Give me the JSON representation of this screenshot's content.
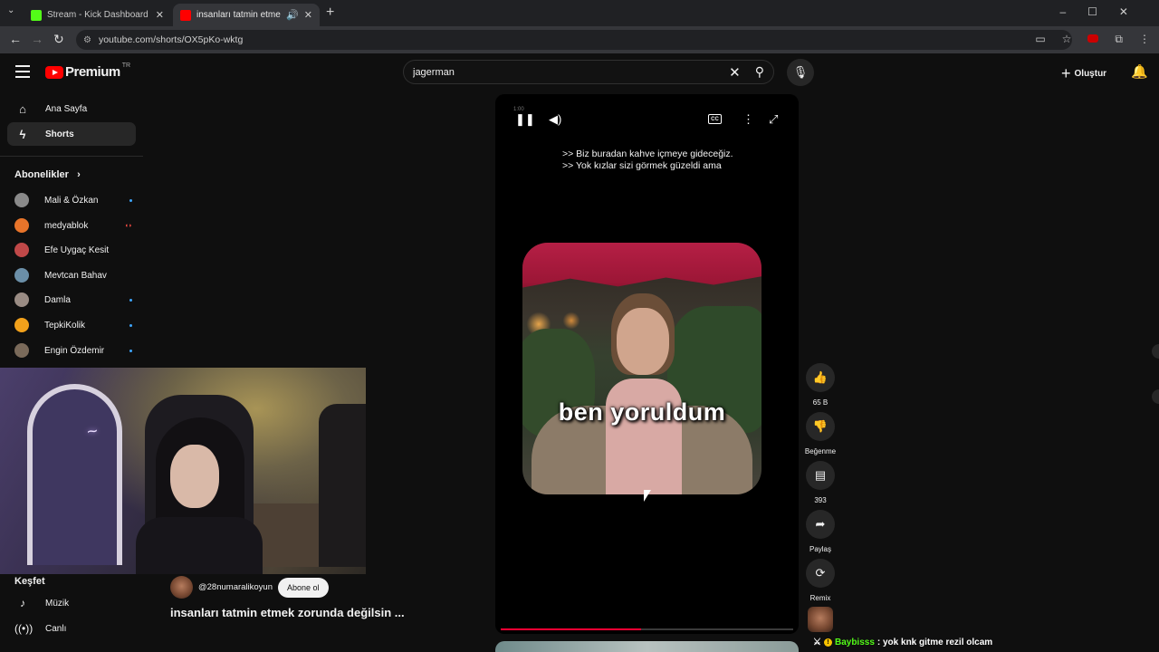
{
  "browser": {
    "tabs": [
      {
        "title": "Stream - Kick Dashboard",
        "favicon_color": "#53fc18"
      },
      {
        "title": "insanları tatmin etmek zoru",
        "favicon_color": "#ff0000"
      }
    ],
    "url": "youtube.com/shorts/OX5pKo-wktg"
  },
  "header": {
    "logo_text": "Premium",
    "logo_sup": "TR",
    "search_value": "jagerman",
    "create_label": "Oluştur"
  },
  "sidebar": {
    "home": "Ana Sayfa",
    "shorts": "Shorts",
    "subscriptions_header": "Abonelikler",
    "subscriptions": [
      {
        "name": "Mali & Özkan",
        "color": "#8a8a8a"
      },
      {
        "name": "medyablok",
        "color": "#e8742a"
      },
      {
        "name": "Efe Uygaç Kesit",
        "color": "#c04848"
      },
      {
        "name": "Mevtcan Bahav",
        "color": "#6b8fa8"
      },
      {
        "name": "Damla",
        "color": "#9a8c84"
      },
      {
        "name": "TepkiKolik",
        "color": "#f2a11b"
      },
      {
        "name": "Engin Özdemir",
        "color": "#7a6a5a"
      }
    ],
    "explore_header": "Keşfet",
    "explore": [
      {
        "label": "Müzik",
        "icon": "music-note-icon"
      },
      {
        "label": "Canlı",
        "icon": "live-icon"
      }
    ]
  },
  "short": {
    "time": "1:00",
    "captions": [
      ">> Biz buradan kahve içmeye gideceğiz.",
      ">> Yok kızlar sizi görmek güzeldi ama"
    ],
    "overlay_text": "ben yoruldum",
    "progress": 0.48,
    "channel": "@28numaralikoyun",
    "subscribe_label": "Abone ol",
    "title": "insanları tatmin etmek zorunda değilsin ..."
  },
  "actions": {
    "likes": "65 B",
    "dislike_label": "Beğenme",
    "comments": "393",
    "share_label": "Paylaş",
    "remix_label": "Remix"
  },
  "chat": {
    "user": "Baybisss",
    "message": ": yok knk gitme rezil olcam"
  }
}
